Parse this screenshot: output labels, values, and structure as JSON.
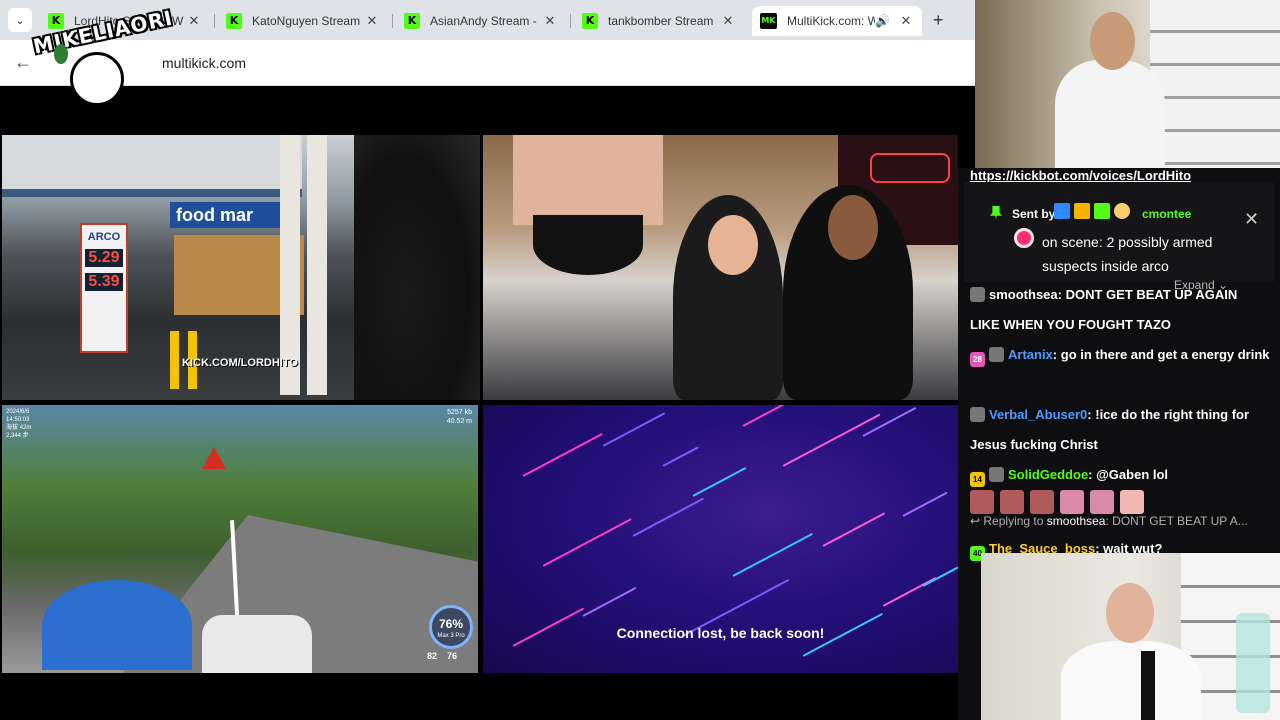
{
  "browser": {
    "tabs": [
      {
        "title": "LordHito Stream - W",
        "favicon": "K",
        "active": false
      },
      {
        "title": "KatoNguyen Stream",
        "favicon": "K",
        "active": false
      },
      {
        "title": "AsianAndy Stream -",
        "favicon": "K",
        "active": false
      },
      {
        "title": "tankbomber Stream",
        "favicon": "K",
        "active": false
      },
      {
        "title": "MultiKick.com: W",
        "favicon": "MK",
        "active": true
      }
    ],
    "url": "multikick.com",
    "new_tab_label": "+",
    "close_label": "✕",
    "back_label": "←",
    "menu_label": "⌄",
    "speaker_label": "🔊"
  },
  "overlay": {
    "logo_text": "MIKELIAORI"
  },
  "streams": {
    "v1": {
      "store_sign": "food mar",
      "brand": "ARCO",
      "price1": "5.29",
      "price2": "5.39",
      "watermark": "KICK.COM/LORDHITO"
    },
    "v3": {
      "hud_left": [
        "2024/6/6",
        "14:50:03",
        "海拔 42m",
        "2,344 步"
      ],
      "hud_right": [
        "5257 kb",
        "40.52 m"
      ],
      "battery": "76%",
      "battery_sub": "Max 3 Pro",
      "stat1": "82",
      "stat2": "76"
    },
    "v4": {
      "message": "Connection lost, be back soon!"
    }
  },
  "chat": {
    "link": "https://kickbot.com/voices/LordHito",
    "pinned": {
      "sent_by_label": "Sent by",
      "username": "cmontee",
      "message": "on scene: 2 possibly armed suspects inside arco",
      "expand_label": "Expand ⌄",
      "close_label": "✕"
    },
    "messages": [
      {
        "badge": "",
        "user": "smoothsea",
        "text": "DONT GET BEAT UP AGAIN LIKE WHEN YOU FOUGHT TAZO",
        "color": "#ffffff"
      },
      {
        "badge": "28",
        "user": "Artanix",
        "text": "go in there and get a energy drink",
        "color": "#4a9dff"
      },
      {
        "badge": "",
        "user": "Verbal_Abuser0",
        "text": "!ice do the right thing for Jesus fucking Christ",
        "color": "#4a9dff"
      },
      {
        "badge": "14",
        "user": "SolidGeddoe",
        "text": "@Gaben lol",
        "color": "#53fc18"
      },
      {
        "badge": "40",
        "user": "The_Sauce_boss",
        "text": "wait wut?",
        "color": "#ffcc33"
      }
    ],
    "reply": {
      "prefix": "Replying to",
      "user": "smoothsea",
      "text": "DONT GET BEAT UP A..."
    }
  },
  "colors": {
    "kick_green": "#53fc18",
    "chat_bg": "#0e0e10",
    "tab_strip": "#dfe3e8"
  }
}
